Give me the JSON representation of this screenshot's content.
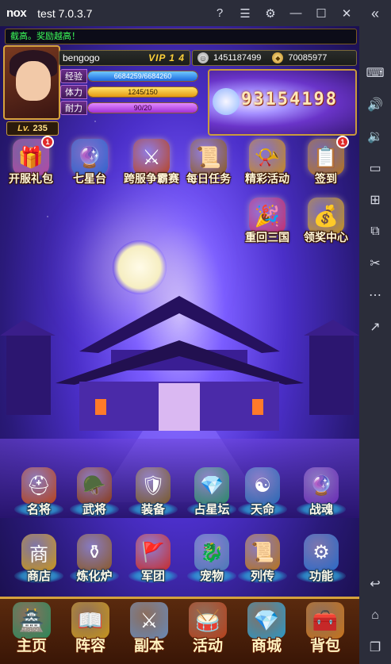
{
  "window": {
    "app_name": "nox",
    "title": "test 7.0.3.7",
    "buttons": [
      "help-icon",
      "menu-icon",
      "settings-icon",
      "minimize-icon",
      "maximize-icon",
      "close-icon"
    ],
    "collapse": "«"
  },
  "toolbar": [
    "keyboard-icon",
    "volume-up-icon",
    "volume-down-icon",
    "screen-icon",
    "apk-install-icon",
    "multi-instance-icon",
    "scissors-icon",
    "more-icon",
    "share-icon",
    "back-icon",
    "home-icon",
    "recents-icon"
  ],
  "banner": {
    "text": "截高。奖励越高！"
  },
  "player": {
    "name": "bengogo",
    "vip": "VIP 1 4",
    "level_label": "Lv.",
    "level": "235",
    "silver": "1451187499",
    "gold": "70085977",
    "power": "93154198",
    "stats": [
      {
        "label": "经验",
        "text": "6684259/6684260",
        "fraction": 0.999
      },
      {
        "label": "体力",
        "text": "1245/150",
        "fraction": 1.0
      },
      {
        "label": "耐力",
        "text": "90/20",
        "fraction": 1.0
      }
    ]
  },
  "top_icons": [
    {
      "label": "开服礼包",
      "icon": "gift-box-icon",
      "badge": "1",
      "color": "#b5479f"
    },
    {
      "label": "七星台",
      "icon": "crystal-orb-icon",
      "badge": "",
      "color": "#2c63c9"
    },
    {
      "label": "跨服争霸赛",
      "icon": "battle-tournament-icon",
      "badge": "",
      "color": "#b8411a"
    },
    {
      "label": "每日任务",
      "icon": "scroll-quest-icon",
      "badge": "",
      "color": "#8a5a1a"
    },
    {
      "label": "精彩活动",
      "icon": "horn-icon",
      "badge": "",
      "color": "#c98a1a"
    },
    {
      "label": "签到",
      "icon": "signin-scroll-icon",
      "badge": "1",
      "color": "#b8741a"
    },
    {
      "label": "重回三国",
      "icon": "treasure-chest-icon",
      "badge": "",
      "color": "#c92a6a"
    },
    {
      "label": "领奖中心",
      "icon": "reward-chest-icon",
      "badge": "",
      "color": "#c9961a"
    }
  ],
  "function_icons": [
    {
      "label": "名将",
      "icon": "general-helmet-icon",
      "badge": "",
      "color": "#b8411a"
    },
    {
      "label": "武将",
      "icon": "warrior-helmet-icon",
      "badge": "",
      "color": "#8a3a1a"
    },
    {
      "label": "装备",
      "icon": "armor-icon",
      "badge": "",
      "color": "#7a5a2a"
    },
    {
      "label": "占星坛",
      "icon": "star-crystal-icon",
      "badge": "",
      "color": "#2a8a6a"
    },
    {
      "label": "天命",
      "icon": "destiny-compass-icon",
      "badge": "",
      "color": "#2a6ab8"
    },
    {
      "label": "战魂",
      "icon": "war-soul-orb-icon",
      "badge": "",
      "color": "#6a2ab8"
    },
    {
      "label": "商店",
      "icon": "shop-sign-icon",
      "badge": "",
      "color": "#c9961a"
    },
    {
      "label": "炼化炉",
      "icon": "furnace-icon",
      "badge": "",
      "color": "#8a5a2a"
    },
    {
      "label": "军团",
      "icon": "legion-flag-icon",
      "badge": "",
      "color": "#c92a2a"
    },
    {
      "label": "宠物",
      "icon": "pet-dragon-icon",
      "badge": "",
      "color": "#4a7ab8"
    },
    {
      "label": "列传",
      "icon": "biography-scroll-icon",
      "badge": "",
      "color": "#b8741a"
    },
    {
      "label": "功能",
      "icon": "function-gear-icon",
      "badge": "",
      "color": "#2a6ac9"
    }
  ],
  "nav": [
    {
      "label": "主页",
      "icon": "home-pavilion-icon",
      "color": "#2a8a5a"
    },
    {
      "label": "阵容",
      "icon": "formation-book-icon",
      "color": "#c9961a"
    },
    {
      "label": "副本",
      "icon": "crossed-swords-icon",
      "color": "#6a8ab8"
    },
    {
      "label": "活动",
      "icon": "war-drum-icon",
      "color": "#b8411a"
    },
    {
      "label": "商城",
      "icon": "gem-shop-icon",
      "color": "#2a9ac9"
    },
    {
      "label": "背包",
      "icon": "backpack-chest-icon",
      "color": "#c9741a"
    }
  ]
}
